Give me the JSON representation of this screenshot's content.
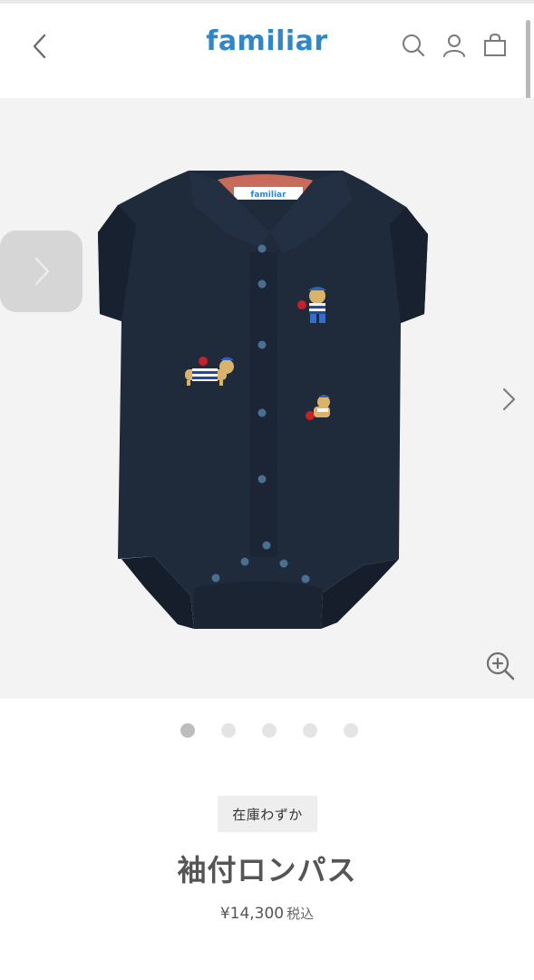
{
  "header": {
    "logo_text": "familiar"
  },
  "icons": {
    "back": "chevron-left-icon",
    "search": "search-icon",
    "account": "user-icon",
    "bag": "shopping-bag-icon",
    "prev": "chevron-right-icon",
    "next": "chevron-right-icon",
    "zoom": "zoom-in-icon"
  },
  "colors": {
    "brand": "#2f86c9",
    "garment": "#1f2a3b",
    "gallery_bg": "#f3f3f3"
  },
  "gallery": {
    "image_count": 5,
    "active_index": 0
  },
  "product": {
    "stock_label": "在庫わずか",
    "name": "袖付ロンパス",
    "price": "¥14,300",
    "tax_label": "税込",
    "label_tag_text": "familiar"
  }
}
